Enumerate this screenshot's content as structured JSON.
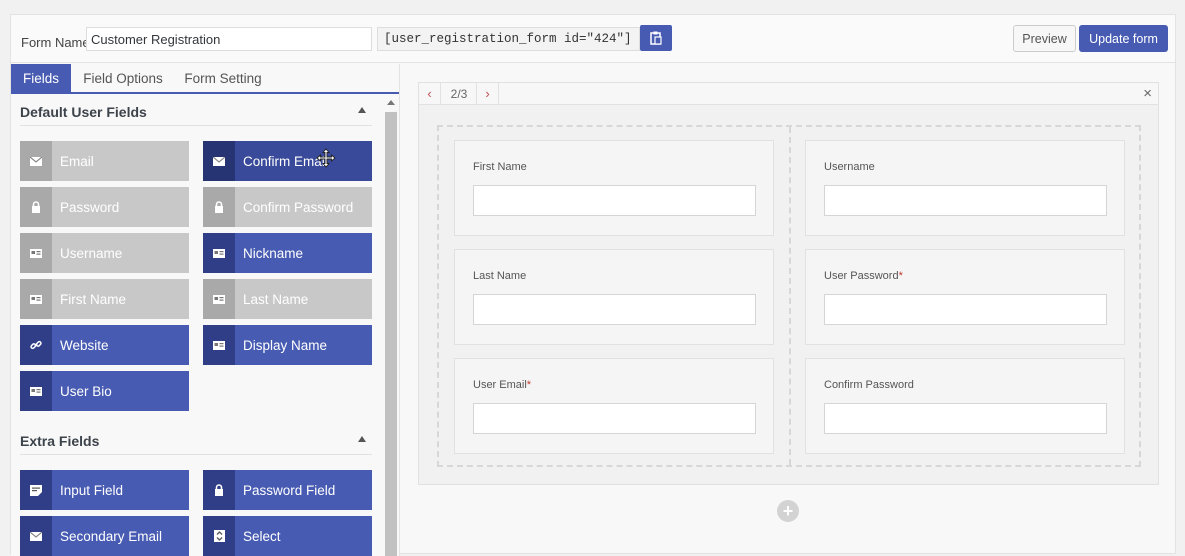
{
  "header": {
    "form_name_label": "Form Name",
    "form_name_value": "Customer Registration",
    "shortcode": "[user_registration_form id=\"424\"]",
    "preview_label": "Preview",
    "update_label": "Update form"
  },
  "tabs": [
    {
      "label": "Fields",
      "active": true
    },
    {
      "label": "Field Options",
      "active": false
    },
    {
      "label": "Form Setting",
      "active": false
    }
  ],
  "sections": {
    "default_title": "Default User Fields",
    "extra_title": "Extra Fields"
  },
  "default_fields": [
    {
      "label": "Email",
      "icon": "envelope-icon",
      "state": "disabled"
    },
    {
      "label": "Confirm Email",
      "icon": "envelope-icon",
      "state": "dragging"
    },
    {
      "label": "Password",
      "icon": "lock-icon",
      "state": "disabled"
    },
    {
      "label": "Confirm Password",
      "icon": "lock-icon",
      "state": "disabled"
    },
    {
      "label": "Username",
      "icon": "id-card-icon",
      "state": "disabled"
    },
    {
      "label": "Nickname",
      "icon": "id-card-icon",
      "state": "enabled"
    },
    {
      "label": "First Name",
      "icon": "id-card-icon",
      "state": "disabled"
    },
    {
      "label": "Last Name",
      "icon": "id-card-icon",
      "state": "disabled"
    },
    {
      "label": "Website",
      "icon": "link-icon",
      "state": "enabled"
    },
    {
      "label": "Display Name",
      "icon": "id-card-icon",
      "state": "enabled"
    },
    {
      "label": "User Bio",
      "icon": "id-card-icon",
      "state": "enabled"
    }
  ],
  "extra_fields": [
    {
      "label": "Input Field",
      "icon": "note-icon",
      "state": "enabled"
    },
    {
      "label": "Password Field",
      "icon": "lock-icon",
      "state": "enabled"
    },
    {
      "label": "Secondary Email",
      "icon": "envelope-icon",
      "state": "enabled"
    },
    {
      "label": "Select",
      "icon": "select-icon",
      "state": "enabled"
    }
  ],
  "canvas": {
    "page_indicator": "2/3",
    "prev_symbol": "‹",
    "next_symbol": "›",
    "close_symbol": "×",
    "add_symbol": "+"
  },
  "form_fields": {
    "left": [
      {
        "label": "First Name",
        "required": ""
      },
      {
        "label": "Last Name",
        "required": ""
      },
      {
        "label": "User Email",
        "required": "*"
      }
    ],
    "right": [
      {
        "label": "Username",
        "required": ""
      },
      {
        "label": "User Password",
        "required": "*"
      },
      {
        "label": "Confirm Password",
        "required": ""
      }
    ]
  },
  "colors": {
    "accent": "#475bb2",
    "disabled": "#c8c8c8",
    "required": "#c0392b"
  }
}
